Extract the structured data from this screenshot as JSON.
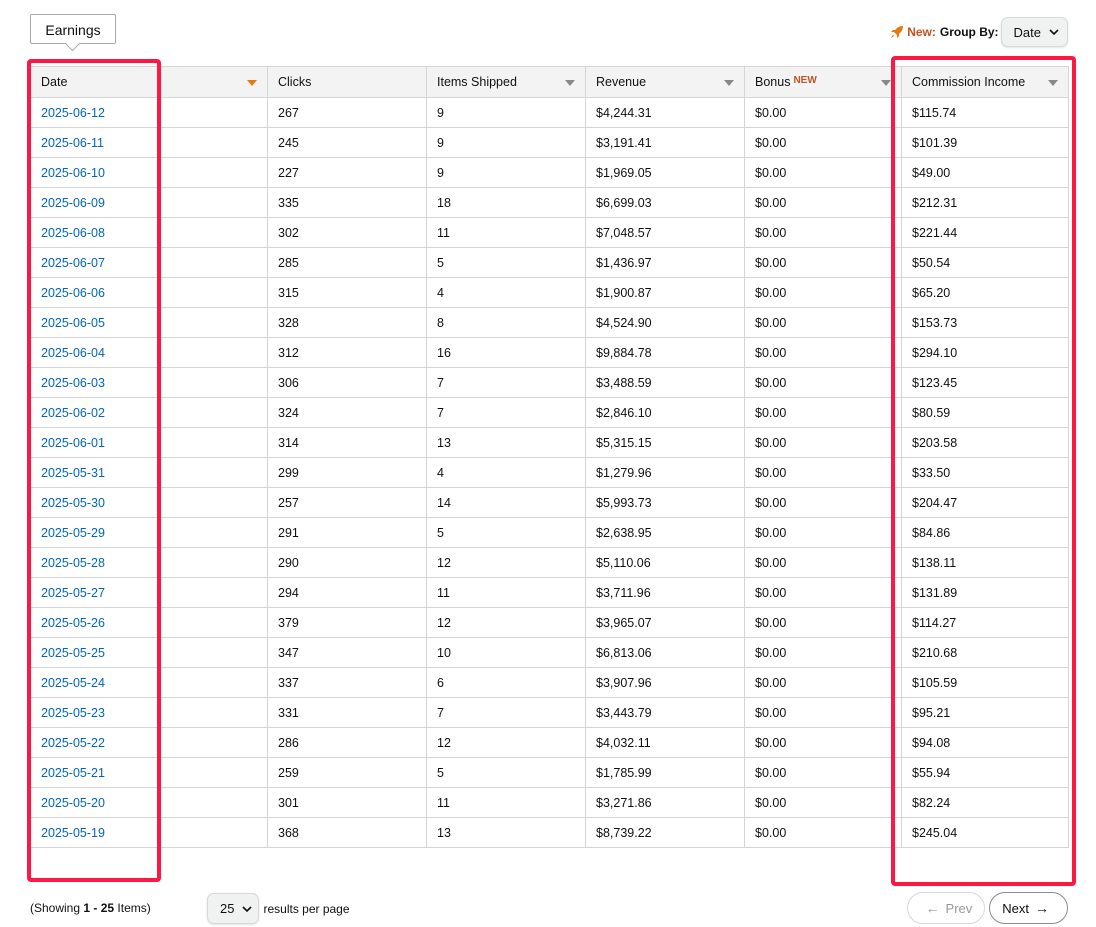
{
  "tab": {
    "label": "Earnings"
  },
  "groupby": {
    "new_label": "New:",
    "label": "Group By:",
    "value": "Date"
  },
  "columns": [
    {
      "label": "Date"
    },
    {
      "label": "Clicks"
    },
    {
      "label": "Items Shipped"
    },
    {
      "label": "Revenue"
    },
    {
      "label": "Bonus",
      "tag": "NEW"
    },
    {
      "label": "Commission Income"
    }
  ],
  "rows": [
    [
      "2025-06-12",
      "267",
      "9",
      "$4,244.31",
      "$0.00",
      "$115.74"
    ],
    [
      "2025-06-11",
      "245",
      "9",
      "$3,191.41",
      "$0.00",
      "$101.39"
    ],
    [
      "2025-06-10",
      "227",
      "9",
      "$1,969.05",
      "$0.00",
      "$49.00"
    ],
    [
      "2025-06-09",
      "335",
      "18",
      "$6,699.03",
      "$0.00",
      "$212.31"
    ],
    [
      "2025-06-08",
      "302",
      "11",
      "$7,048.57",
      "$0.00",
      "$221.44"
    ],
    [
      "2025-06-07",
      "285",
      "5",
      "$1,436.97",
      "$0.00",
      "$50.54"
    ],
    [
      "2025-06-06",
      "315",
      "4",
      "$1,900.87",
      "$0.00",
      "$65.20"
    ],
    [
      "2025-06-05",
      "328",
      "8",
      "$4,524.90",
      "$0.00",
      "$153.73"
    ],
    [
      "2025-06-04",
      "312",
      "16",
      "$9,884.78",
      "$0.00",
      "$294.10"
    ],
    [
      "2025-06-03",
      "306",
      "7",
      "$3,488.59",
      "$0.00",
      "$123.45"
    ],
    [
      "2025-06-02",
      "324",
      "7",
      "$2,846.10",
      "$0.00",
      "$80.59"
    ],
    [
      "2025-06-01",
      "314",
      "13",
      "$5,315.15",
      "$0.00",
      "$203.58"
    ],
    [
      "2025-05-31",
      "299",
      "4",
      "$1,279.96",
      "$0.00",
      "$33.50"
    ],
    [
      "2025-05-30",
      "257",
      "14",
      "$5,993.73",
      "$0.00",
      "$204.47"
    ],
    [
      "2025-05-29",
      "291",
      "5",
      "$2,638.95",
      "$0.00",
      "$84.86"
    ],
    [
      "2025-05-28",
      "290",
      "12",
      "$5,110.06",
      "$0.00",
      "$138.11"
    ],
    [
      "2025-05-27",
      "294",
      "11",
      "$3,711.96",
      "$0.00",
      "$131.89"
    ],
    [
      "2025-05-26",
      "379",
      "12",
      "$3,965.07",
      "$0.00",
      "$114.27"
    ],
    [
      "2025-05-25",
      "347",
      "10",
      "$6,813.06",
      "$0.00",
      "$210.68"
    ],
    [
      "2025-05-24",
      "337",
      "6",
      "$3,907.96",
      "$0.00",
      "$105.59"
    ],
    [
      "2025-05-23",
      "331",
      "7",
      "$3,443.79",
      "$0.00",
      "$95.21"
    ],
    [
      "2025-05-22",
      "286",
      "12",
      "$4,032.11",
      "$0.00",
      "$94.08"
    ],
    [
      "2025-05-21",
      "259",
      "5",
      "$1,785.99",
      "$0.00",
      "$55.94"
    ],
    [
      "2025-05-20",
      "301",
      "11",
      "$3,271.86",
      "$0.00",
      "$82.24"
    ],
    [
      "2025-05-19",
      "368",
      "13",
      "$8,739.22",
      "$0.00",
      "$245.04"
    ]
  ],
  "footer": {
    "showing_prefix": "(Showing ",
    "showing_range": "1 - 25",
    "showing_suffix": " Items)",
    "per_page_value": "25",
    "per_page_label": "results per page",
    "prev_label": "Prev",
    "next_label": "Next"
  },
  "colors": {
    "highlight": "#ff1744",
    "link": "#0066c0",
    "accent": "#c7511f",
    "sort_active": "#e47911"
  }
}
